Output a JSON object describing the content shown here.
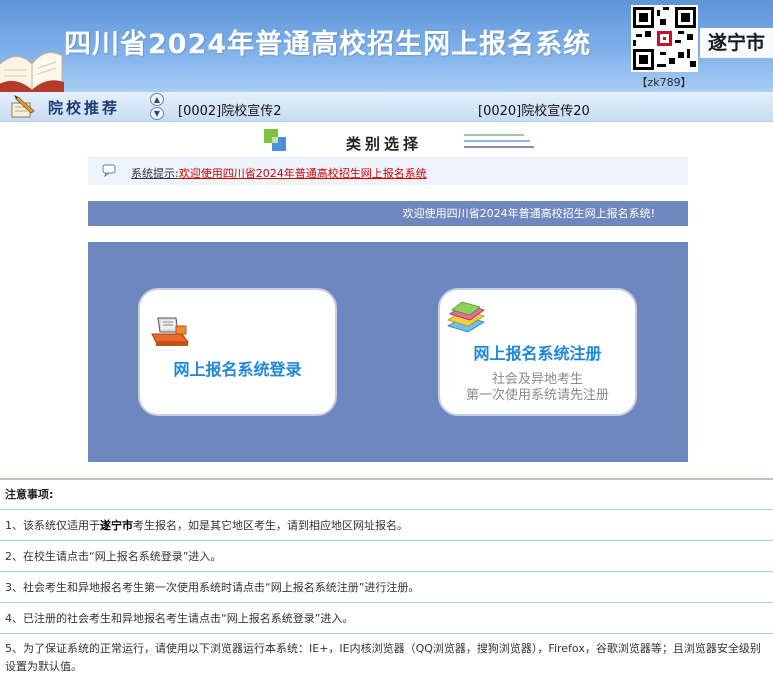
{
  "header": {
    "title": "四川省2024年普通高校招生网上报名系统",
    "city": "遂宁市",
    "qr_code_label": "【zk789】"
  },
  "recommend": {
    "label": "院校推荐",
    "items": [
      "[0002]院校宣传2",
      "[0020]院校宣传20"
    ]
  },
  "category": {
    "label": "类别选择"
  },
  "tip": {
    "label": "系统提示:",
    "link_text": "欢迎使用四川省2024年普通高校招生网上报名系统"
  },
  "welcome": {
    "text": "欢迎使用四川省2024年普通高校招生网上报名系统!"
  },
  "cards": {
    "login": {
      "title": "网上报名系统登录"
    },
    "register": {
      "title": "网上报名系统注册",
      "sub_line1": "社会及异地考生",
      "sub_line2": "第一次使用系统请先注册"
    }
  },
  "notes": {
    "title": "注意事项:",
    "n1_prefix": "1、该系统仅适用于",
    "n1_city": "遂宁市",
    "n1_suffix": "考生报名，如是其它地区考生，请到相应地区网址报名。",
    "n2": "2、在校生请点击“网上报名系统登录”进入。",
    "n3": "3、社会考生和异地报名考生第一次使用系统时请点击“网上报名系统注册”进行注册。",
    "n4": "4、已注册的社会考生和异地报名考生请点击“网上报名系统登录”进入。",
    "n5": "5、为了保证系统的正常运行，请使用以下浏览器运行本系统：IE+，IE内核浏览器（QQ浏览器，搜狗浏览器），Firefox，谷歌浏览器等；且浏览器安全级别设置为默认值。"
  }
}
